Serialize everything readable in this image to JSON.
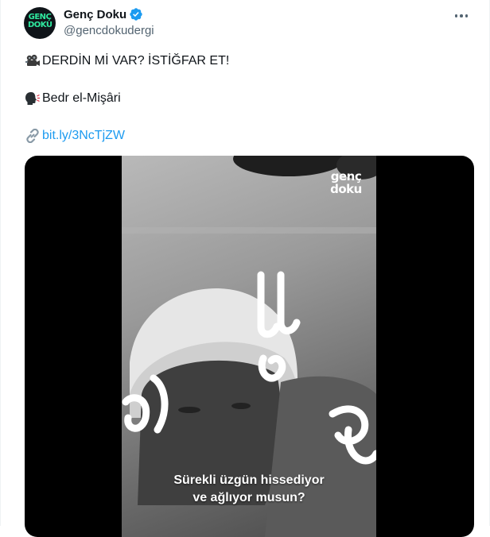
{
  "tweet": {
    "author": {
      "display_name": "Genç Doku",
      "handle": "@gencdokudergi",
      "verified": true,
      "avatar_logo_line1": "GENÇ",
      "avatar_logo_line2": "DOKU"
    },
    "more_icon": "more-horizontal-icon",
    "lines": [
      {
        "emoji": "movie-camera-icon",
        "text": "DERDİN Mİ VAR? İSTİĞFAR ET!"
      },
      {
        "emoji": "speaking-head-icon",
        "text": "Bedr el-Mişâri"
      },
      {
        "emoji": "link-icon",
        "text": "bit.ly/3NcTjZW"
      }
    ],
    "media": {
      "watermark_line1": "genç",
      "watermark_line2": "doku",
      "subtitle_line1": "Sürekli üzgün hissediyor",
      "subtitle_line2": "ve ağlıyor musun?"
    }
  },
  "colors": {
    "link": "#1d9bf0",
    "text": "#0f1419",
    "secondary": "#536471",
    "verified": "#1d9bf0",
    "brand_green": "#2fe89f"
  }
}
